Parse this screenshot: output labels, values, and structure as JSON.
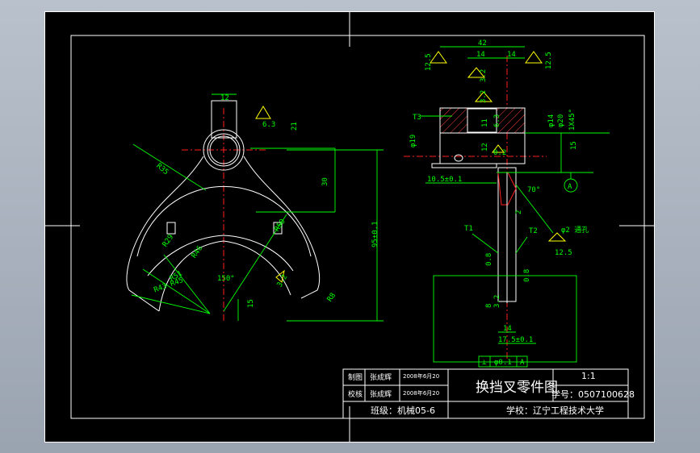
{
  "title_block": {
    "drawing_title": "换挡叉零件图",
    "scale": "1:1",
    "student_no": "学号：0507100628",
    "school": "学校：辽宁工程技术大学",
    "class": "班级：机械05-6",
    "rows": [
      {
        "role": "制图",
        "name": "张成辉",
        "date": "2008年6月20"
      },
      {
        "role": "校核",
        "name": "张成辉",
        "date": "2008年6月20"
      }
    ]
  },
  "front_view_dims": [
    "12",
    "6.3",
    "21",
    "R35",
    "30",
    "95±0.1",
    "R50",
    "R29",
    "R46",
    "R51",
    "R45",
    "R43",
    "R8",
    "150°",
    "3.2",
    "15"
  ],
  "side_view_dims": [
    "42",
    "14",
    "14",
    "12.5",
    "12.5",
    "3.2",
    "3.2",
    "T3",
    "11",
    "6.3",
    "φ19",
    "12",
    "0.2",
    "φ14",
    "φ20",
    "1X45°",
    "15",
    "10.5±0.1",
    "70°",
    "A",
    "2",
    "T1",
    "T2",
    "φ2 通孔",
    "12.5",
    "0.8",
    "0.8",
    "8",
    "3.2",
    "14",
    "17.5±0.1",
    "0.1",
    "A"
  ]
}
